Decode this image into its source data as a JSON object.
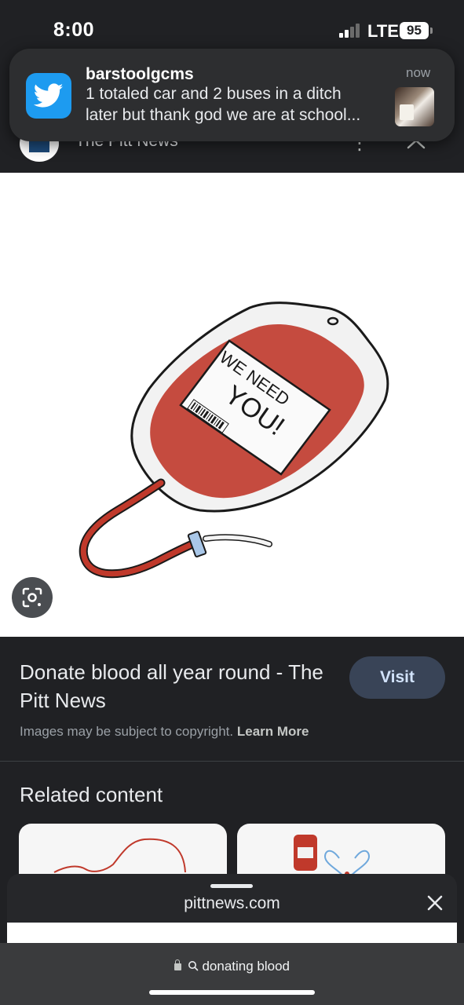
{
  "status_bar": {
    "time": "8:00",
    "network": "LTE",
    "battery": "95",
    "icons": [
      "signal-bars-icon",
      "battery-icon"
    ]
  },
  "notification": {
    "app_icon": "twitter-bird-icon",
    "title": "barstoolgcms",
    "time": "now",
    "line1": "1 totaled car and 2 buses in a ditch",
    "line2": "later but thank god we are at school..."
  },
  "source_header": {
    "site_name": "The Pitt News",
    "icons": [
      "more-vertical-icon",
      "chevron-up-icon"
    ]
  },
  "image": {
    "bag_label": [
      "WE NEED",
      "YOU!"
    ],
    "colors": {
      "blood": "#c0392b",
      "bag_outline": "#1a1a1a",
      "tube_cap": "#a9c7e8"
    }
  },
  "result": {
    "title": "Donate blood all year round - The Pitt News",
    "visit_label": "Visit",
    "copyright_text": "Images may be subject to copyright.",
    "learn_more": "Learn More"
  },
  "related": {
    "heading": "Related content"
  },
  "bottom_sheet": {
    "domain": "pittnews.com",
    "close_icon": "close-x-icon"
  },
  "address_bar": {
    "query": "donating blood",
    "icons": [
      "lock-icon",
      "search-icon"
    ]
  },
  "accent_colors": {
    "visit_button_bg": "#394457",
    "twitter_blue": "#1d9bf0",
    "page_bg": "#202124"
  }
}
